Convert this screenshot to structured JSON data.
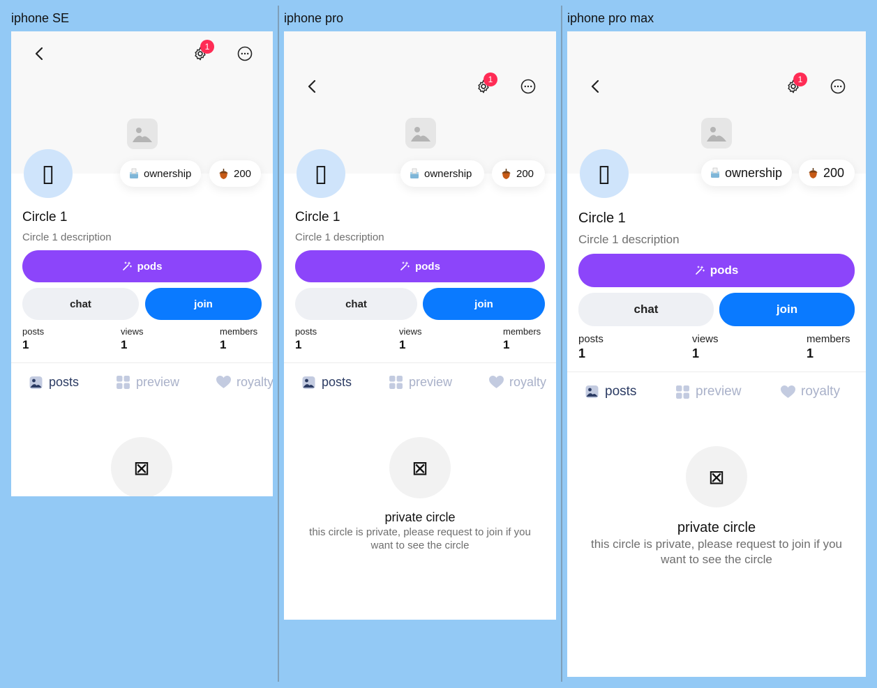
{
  "frames": {
    "se": {
      "label": "iphone SE"
    },
    "pro": {
      "label": "iphone pro"
    },
    "max": {
      "label": "iphone pro max"
    }
  },
  "header": {
    "notification_count": "1"
  },
  "circle": {
    "name": "Circle 1",
    "description": "Circle 1 description",
    "avatar_glyph": "▯",
    "ownership_label": "ownership",
    "coins": "200"
  },
  "actions": {
    "pods_label": "pods",
    "chat_label": "chat",
    "join_label": "join"
  },
  "stats": {
    "posts_label": "posts",
    "posts_value": "1",
    "views_label": "views",
    "views_value": "1",
    "members_label": "members",
    "members_value": "1"
  },
  "tabs": {
    "posts": "posts",
    "preview": "preview",
    "royalty": "royalty"
  },
  "private": {
    "glyph": "⊠",
    "title": "private circle",
    "message": "this circle is private, please request to join if you want to see the circle"
  },
  "colors": {
    "background": "#93c9f5",
    "accent_purple": "#8c45fa",
    "accent_blue": "#0a7aff",
    "badge_red": "#ff2c55"
  }
}
